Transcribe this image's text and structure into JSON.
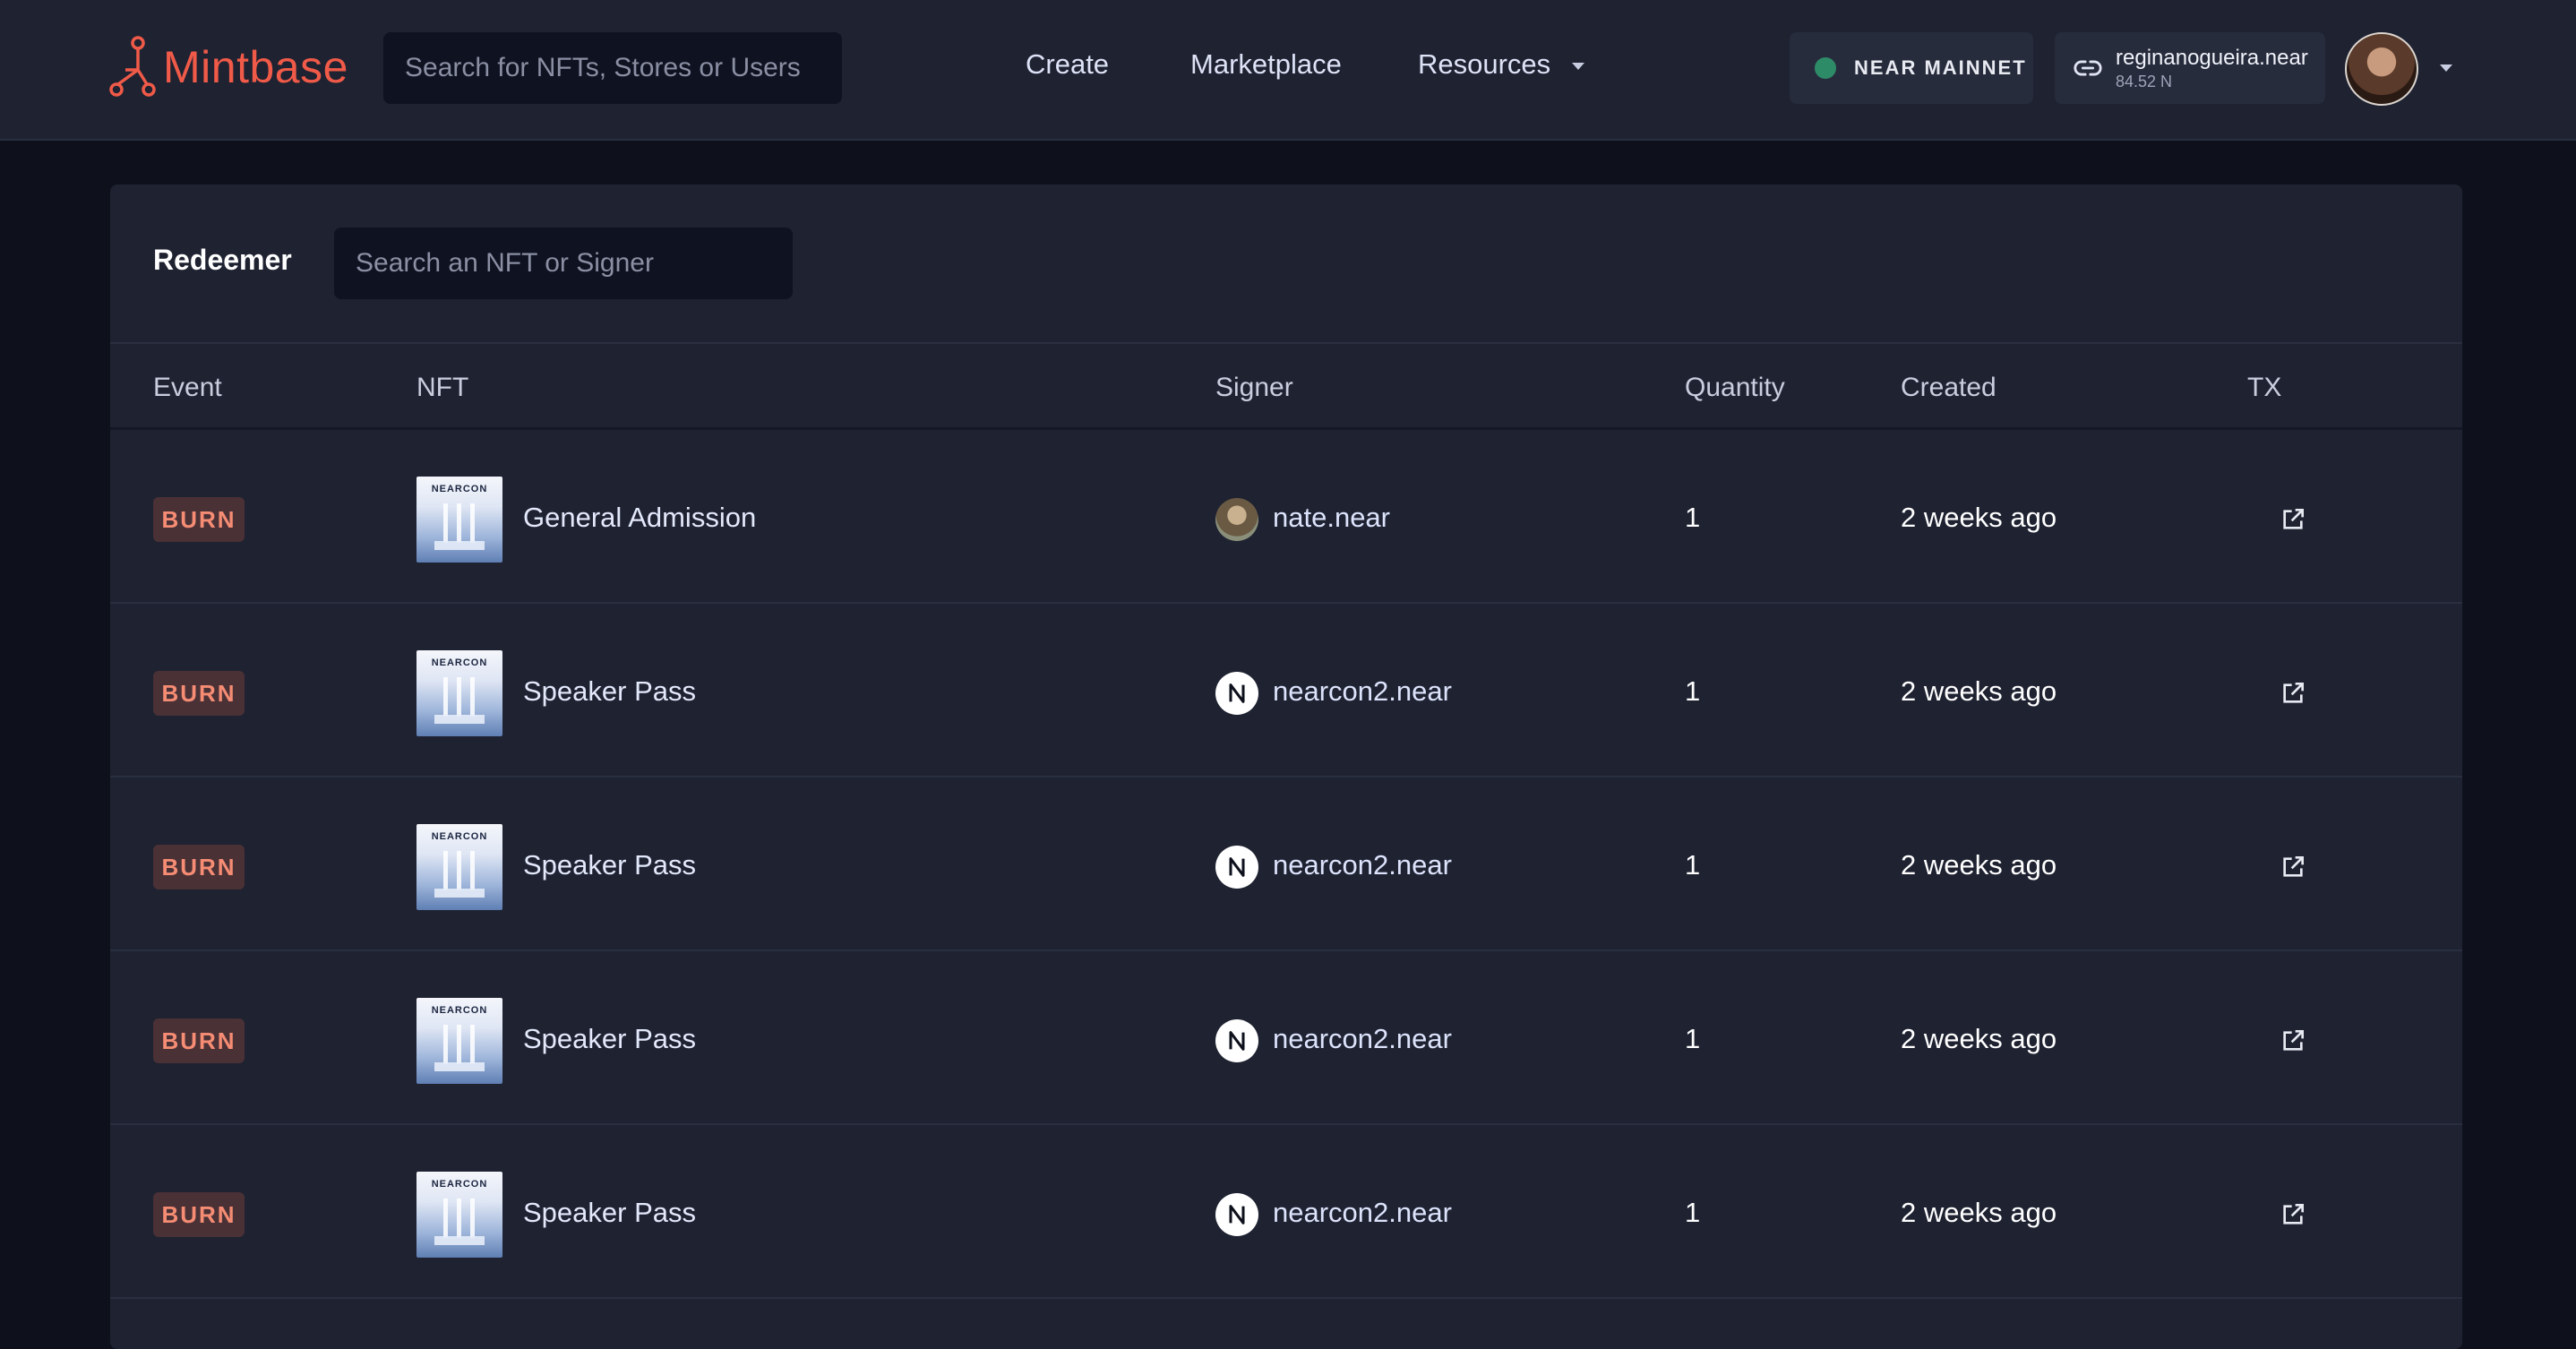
{
  "header": {
    "logo_text": "Mintbase",
    "search_placeholder": "Search for NFTs, Stores or Users",
    "nav": {
      "create": "Create",
      "marketplace": "Marketplace",
      "resources": "Resources"
    },
    "network_label": "NEAR MAINNET",
    "network_status_color": "#2e8b68",
    "wallet": {
      "account": "reginanogueira.near",
      "balance": "84.52 N"
    }
  },
  "panel": {
    "title": "Redeemer",
    "search_placeholder": "Search an NFT or Signer",
    "columns": {
      "event": "Event",
      "nft": "NFT",
      "signer": "Signer",
      "quantity": "Quantity",
      "created": "Created",
      "tx": "TX"
    },
    "rows": [
      {
        "event": "BURN",
        "nft": "General Admission",
        "thumb_title": "NEARCON",
        "signer": "nate.near",
        "signer_avatar": "photo",
        "quantity": "1",
        "created": "2 weeks ago"
      },
      {
        "event": "BURN",
        "nft": "Speaker Pass",
        "thumb_title": "NEARCON",
        "signer": "nearcon2.near",
        "signer_avatar": "near-logo",
        "quantity": "1",
        "created": "2 weeks ago"
      },
      {
        "event": "BURN",
        "nft": "Speaker Pass",
        "thumb_title": "NEARCON",
        "signer": "nearcon2.near",
        "signer_avatar": "near-logo",
        "quantity": "1",
        "created": "2 weeks ago"
      },
      {
        "event": "BURN",
        "nft": "Speaker Pass",
        "thumb_title": "NEARCON",
        "signer": "nearcon2.near",
        "signer_avatar": "near-logo",
        "quantity": "1",
        "created": "2 weeks ago"
      },
      {
        "event": "BURN",
        "nft": "Speaker Pass",
        "thumb_title": "NEARCON",
        "signer": "nearcon2.near",
        "signer_avatar": "near-logo",
        "quantity": "1",
        "created": "2 weeks ago"
      }
    ]
  },
  "colors": {
    "brand": "#f05a48",
    "burn_badge_text": "#f58c73",
    "burn_badge_bg": "#4a3136",
    "background": "#0e111c",
    "surface": "#1e2231"
  }
}
